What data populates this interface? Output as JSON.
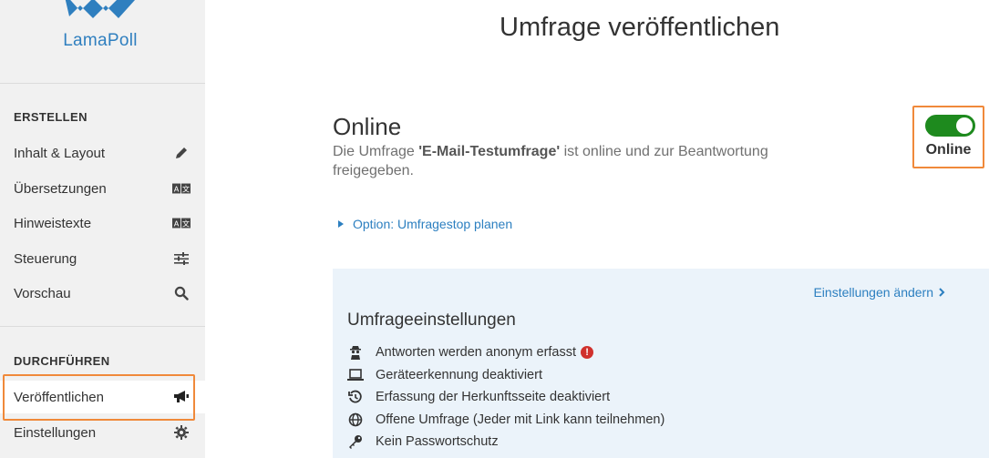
{
  "brand": {
    "name": "LamaPoll",
    "color": "#2f7fbf"
  },
  "sidebar": {
    "sections": [
      {
        "title": "ERSTELLEN"
      },
      {
        "title": "DURCHFÜHREN"
      }
    ],
    "create_items": [
      {
        "label": "Inhalt & Layout",
        "icon": "pencil-icon"
      },
      {
        "label": "Übersetzungen",
        "icon": "translate-icon"
      },
      {
        "label": "Hinweistexte",
        "icon": "translate-icon"
      },
      {
        "label": "Steuerung",
        "icon": "sliders-icon"
      },
      {
        "label": "Vorschau",
        "icon": "search-icon"
      }
    ],
    "run_items": [
      {
        "label": "Veröffentlichen",
        "icon": "megaphone-icon",
        "active": true
      },
      {
        "label": "Einstellungen",
        "icon": "gear-icon"
      }
    ]
  },
  "main": {
    "title": "Umfrage veröffentlichen",
    "status": {
      "heading": "Online",
      "desc_prefix": "Die Umfrage ",
      "survey_name": "'E-Mail-Testumfrage'",
      "desc_suffix": " ist online und zur Beantwortung freigegeben."
    },
    "toggle": {
      "label": "Online",
      "on": true,
      "color": "#1e8a1e"
    },
    "option_link": "Option: Umfragestop planen",
    "settings": {
      "change_link": "Einstellungen ändern",
      "title": "Umfrageeinstellungen",
      "items": [
        {
          "label": "Antworten werden anonym erfasst",
          "icon": "spy-icon",
          "warning": true
        },
        {
          "label": "Geräteerkennung deaktiviert",
          "icon": "laptop-icon"
        },
        {
          "label": "Erfassung der Herkunftsseite deaktiviert",
          "icon": "history-icon"
        },
        {
          "label": "Offene Umfrage (Jeder mit Link kann teilnehmen)",
          "icon": "globe-icon"
        },
        {
          "label": "Kein Passwortschutz",
          "icon": "key-icon"
        }
      ]
    }
  },
  "colors": {
    "accent": "#2c7fc0",
    "highlight": "#f0893a",
    "panel": "#ebf3fa",
    "warning": "#d0312d"
  }
}
